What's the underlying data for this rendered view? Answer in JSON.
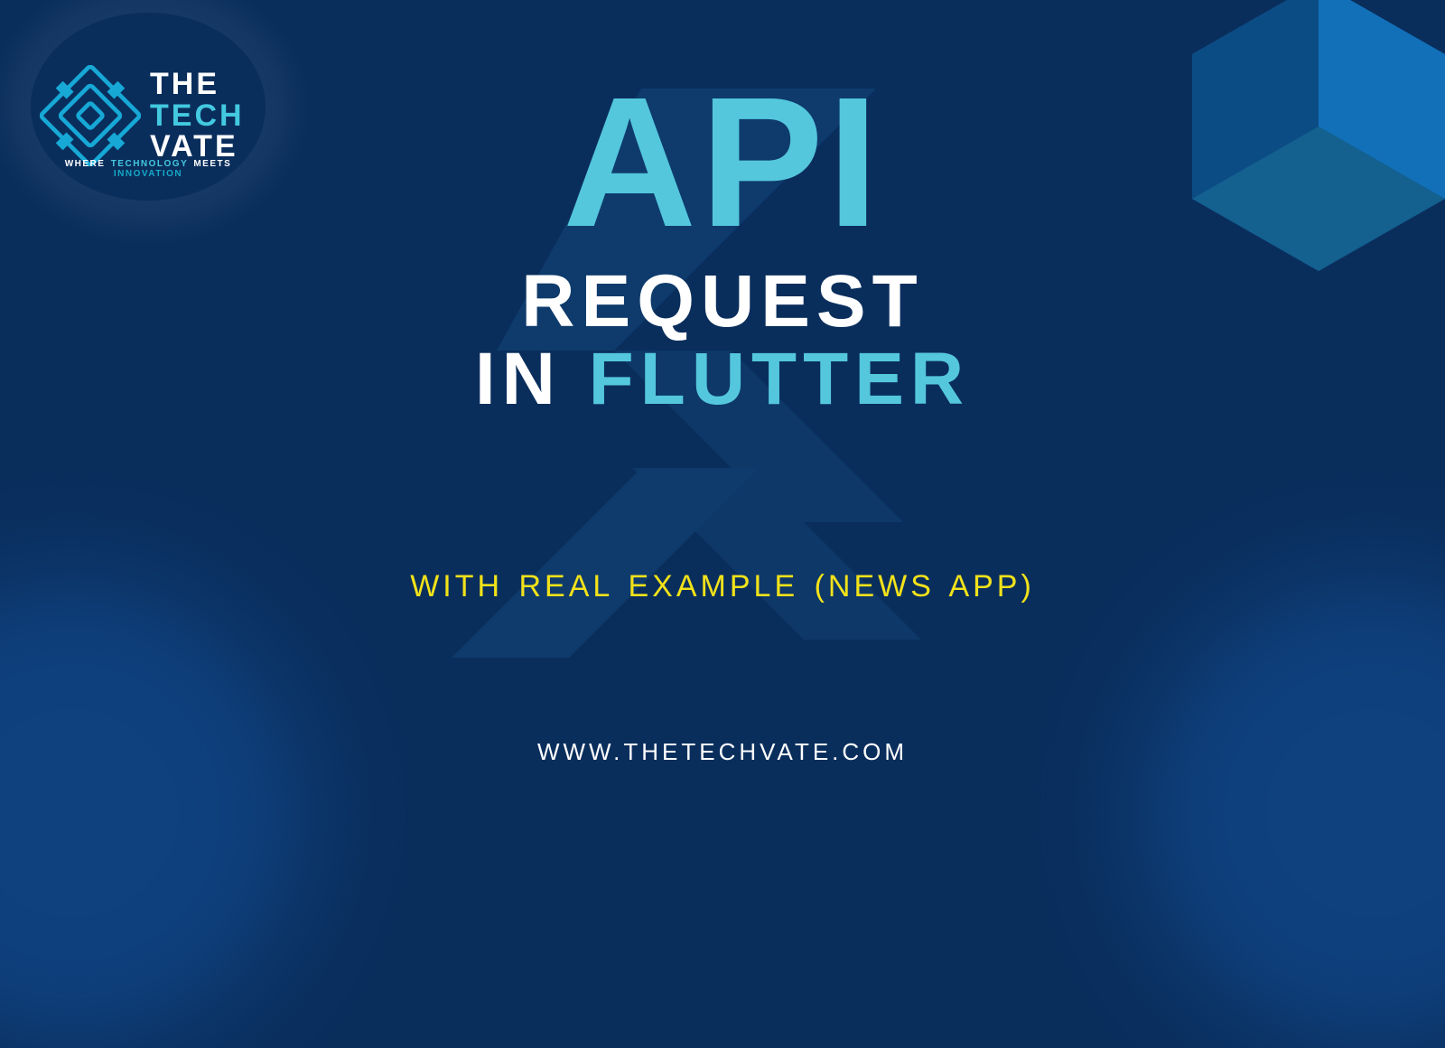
{
  "logo": {
    "line1": "THE",
    "line2": "TECH",
    "line3": "VATE",
    "tagline_pre": "WHERE ",
    "tagline_mid1": "TECHNOLOGY",
    "tagline_mid2": " MEETS ",
    "tagline_mid3": "INNOVATION"
  },
  "headline": {
    "word1": "API",
    "word2": "REQUEST",
    "word3_pre": "IN ",
    "word3_accent": "FLUTTER"
  },
  "subheading": "WITH REAL EXAMPLE (NEWS APP)",
  "footer": "WWW.THETECHVATE.COM",
  "colors": {
    "bg": "#0a2e5c",
    "cyan": "#54c7dd",
    "yellow": "#f2e21a"
  }
}
